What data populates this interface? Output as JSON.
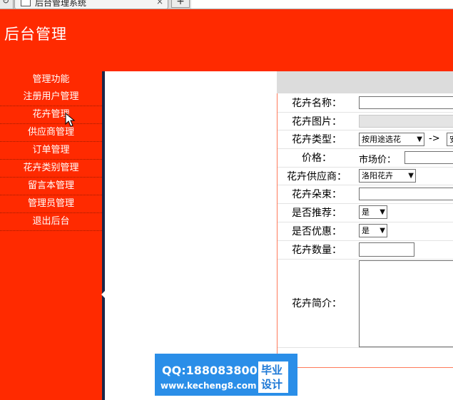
{
  "browser": {
    "tab_title": "后台管理系统",
    "close_glyph": "×",
    "new_tab_glyph": "+"
  },
  "header": {
    "title": "后台管理"
  },
  "sidebar": {
    "heading": "管理功能",
    "items": [
      {
        "label": "注册用户管理"
      },
      {
        "label": "花卉管理"
      },
      {
        "label": "供应商管理"
      },
      {
        "label": "订单管理"
      },
      {
        "label": "花卉类别管理"
      },
      {
        "label": "留言本管理"
      },
      {
        "label": "管理员管理"
      },
      {
        "label": "退出后台"
      }
    ]
  },
  "form": {
    "name_label": "花卉名称：",
    "image_label": "花卉图片：",
    "type_label": "花卉类型：",
    "type_select_value": "按用途选花",
    "type_arrow": "->",
    "subtype_select_value": "安",
    "price_label": "价格：",
    "market_price_label": "市场价：",
    "supplier_label": "花卉供应商：",
    "supplier_select_value": "洛阳花卉",
    "bouquet_label": "花卉朵束：",
    "recommend_label": "是否推荐：",
    "recommend_value": "是",
    "discount_label": "是否优惠：",
    "discount_value": "是",
    "quantity_label": "花卉数量：",
    "intro_label": "花卉简介："
  },
  "watermark": {
    "qq": "QQ:188083800",
    "url": "www.kecheng8.com",
    "badge_line1": "毕业",
    "badge_line2": "设计"
  }
}
